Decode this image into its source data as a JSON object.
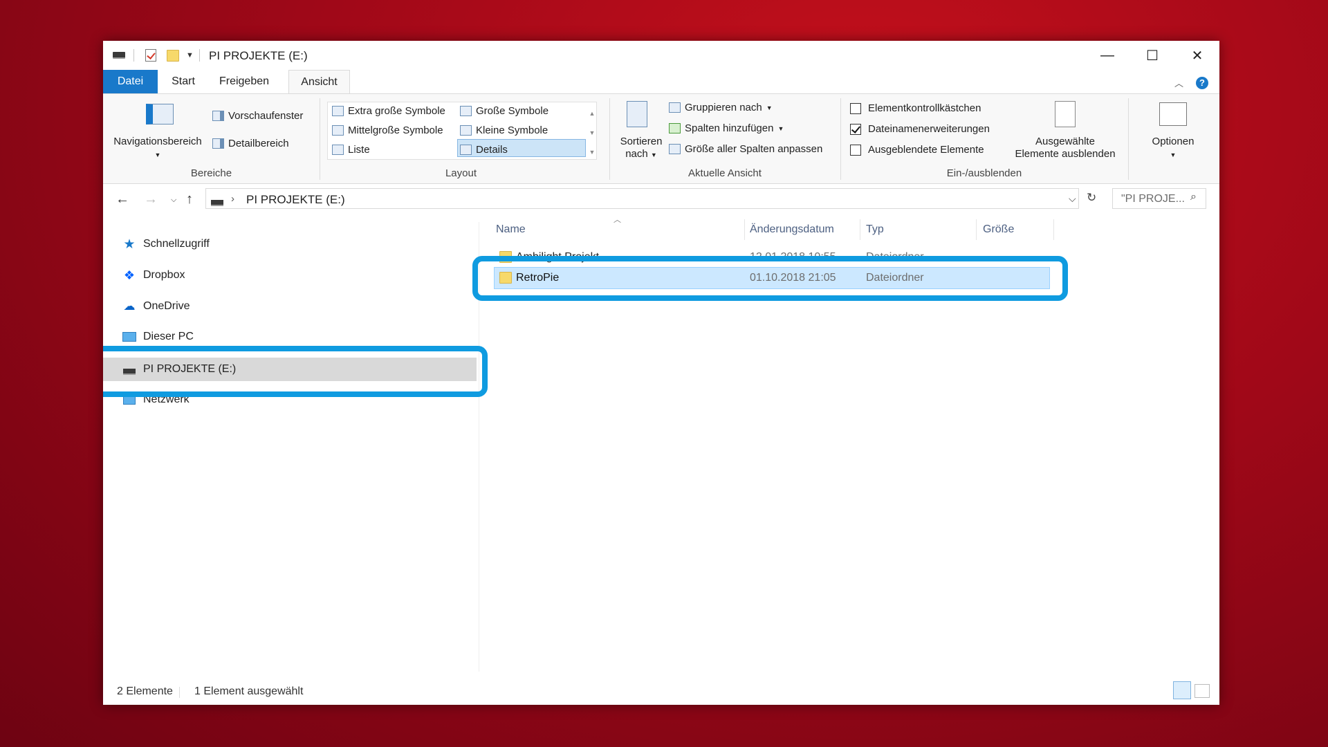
{
  "window": {
    "title": "PI PROJEKTE (E:)",
    "controls": {
      "minimize": "—",
      "maximize": "☐",
      "close": "✕"
    }
  },
  "tabs": [
    "Datei",
    "Start",
    "Freigeben",
    "Ansicht"
  ],
  "ribbon": {
    "bereiche": {
      "nav_label": "Navigationsbereich",
      "preview": "Vorschaufenster",
      "details": "Detailbereich",
      "group": "Bereiche"
    },
    "layout": {
      "items": [
        "Extra große Symbole",
        "Große Symbole",
        "Mittelgroße Symbole",
        "Kleine Symbole",
        "Liste",
        "Details"
      ],
      "selected": "Details",
      "group": "Layout"
    },
    "aktuelle_ansicht": {
      "sort_line1": "Sortieren",
      "sort_line2": "nach",
      "group_by": "Gruppieren nach",
      "add_columns": "Spalten hinzufügen",
      "fit_columns": "Größe aller Spalten anpassen",
      "group": "Aktuelle Ansicht"
    },
    "ein_ausblenden": {
      "checkbox1": {
        "label": "Elementkontrollkästchen",
        "checked": false
      },
      "checkbox2": {
        "label": "Dateinamenerweiterungen",
        "checked": true
      },
      "checkbox3": {
        "label": "Ausgeblendete Elemente",
        "checked": false
      },
      "hide_line1": "Ausgewählte",
      "hide_line2": "Elemente ausblenden",
      "group": "Ein-/ausblenden"
    },
    "optionen": "Optionen"
  },
  "address": {
    "path": "PI PROJEKTE (E:)",
    "search_placeholder": "\"PI PROJE..."
  },
  "nav_pane": {
    "items": [
      "Schnellzugriff",
      "Dropbox",
      "OneDrive",
      "Dieser PC",
      "PI PROJEKTE (E:)",
      "Netzwerk"
    ],
    "selected": "PI PROJEKTE (E:)"
  },
  "file_list": {
    "columns": [
      "Name",
      "Änderungsdatum",
      "Typ",
      "Größe"
    ],
    "rows": [
      {
        "name": "Ambilight Projekt",
        "date": "12.01.2018 10:55",
        "type": "Dateiordner",
        "size": ""
      },
      {
        "name": "RetroPie",
        "date": "01.10.2018 21:05",
        "type": "Dateiordner",
        "size": ""
      }
    ],
    "selected_row": 1
  },
  "status": {
    "count": "2 Elemente",
    "selection": "1 Element ausgewählt"
  },
  "colors": {
    "accent": "#1979ca",
    "highlight_frame": "#0f9be0",
    "selection": "#cce8ff"
  }
}
